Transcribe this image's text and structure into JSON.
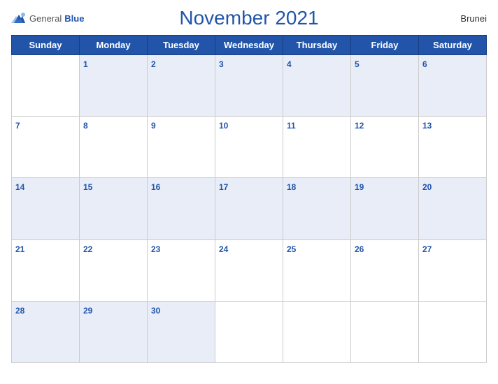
{
  "header": {
    "title": "November 2021",
    "country": "Brunei",
    "logo": {
      "general": "General",
      "blue": "Blue"
    }
  },
  "days_of_week": [
    "Sunday",
    "Monday",
    "Tuesday",
    "Wednesday",
    "Thursday",
    "Friday",
    "Saturday"
  ],
  "weeks": [
    [
      null,
      1,
      2,
      3,
      4,
      5,
      6
    ],
    [
      7,
      8,
      9,
      10,
      11,
      12,
      13
    ],
    [
      14,
      15,
      16,
      17,
      18,
      19,
      20
    ],
    [
      21,
      22,
      23,
      24,
      25,
      26,
      27
    ],
    [
      28,
      29,
      30,
      null,
      null,
      null,
      null
    ]
  ]
}
